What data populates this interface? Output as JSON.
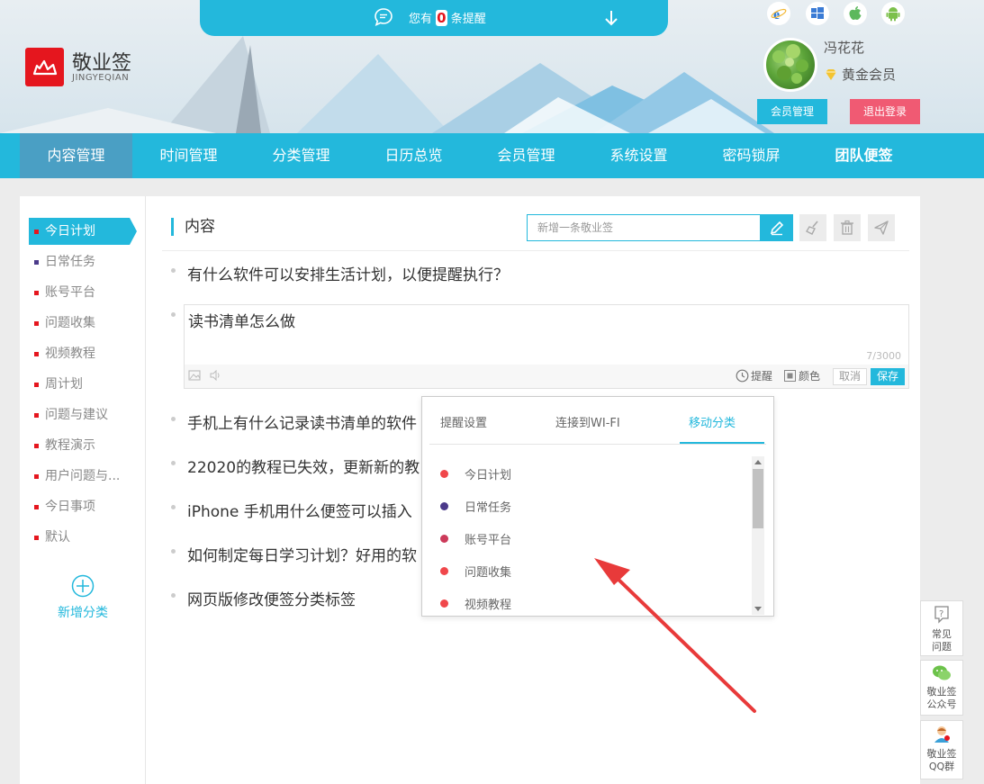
{
  "brand": {
    "name": "敬业签",
    "sub": "JINGYEQIAN"
  },
  "reminder": {
    "prefix": "您有",
    "count": "0",
    "suffix": "条提醒"
  },
  "platforms": [
    "ie-icon",
    "windows-icon",
    "apple-icon",
    "android-icon"
  ],
  "user": {
    "name": "冯花花",
    "level": "黄金会员"
  },
  "header_buttons": {
    "member_manage": "会员管理",
    "logout": "退出登录"
  },
  "nav": [
    "内容管理",
    "时间管理",
    "分类管理",
    "日历总览",
    "会员管理",
    "系统设置",
    "密码锁屏",
    "团队便签"
  ],
  "sidebar": {
    "items": [
      {
        "label": "今日计划",
        "color": "#e5161e"
      },
      {
        "label": "日常任务",
        "color": "#4b3a8a"
      },
      {
        "label": "账号平台",
        "color": "#e5161e"
      },
      {
        "label": "问题收集",
        "color": "#e5161e"
      },
      {
        "label": "视频教程",
        "color": "#e5161e"
      },
      {
        "label": "周计划",
        "color": "#e5161e"
      },
      {
        "label": "问题与建议",
        "color": "#e5161e"
      },
      {
        "label": "教程演示",
        "color": "#e5161e"
      },
      {
        "label": "用户问题与...",
        "color": "#e5161e"
      },
      {
        "label": "今日事项",
        "color": "#e5161e"
      },
      {
        "label": "默认",
        "color": "#e5161e"
      }
    ],
    "add_label": "新增分类"
  },
  "content": {
    "title": "内容",
    "new_placeholder": "新增一条敬业签",
    "notes": [
      "有什么软件可以安排生活计划，以便提醒执行？",
      "手机上有什么记录读书清单的软件",
      "22020的教程已失效，更新新的教",
      "iPhone 手机用什么便签可以插入",
      "如何制定每日学习计划？好用的软",
      "网页版修改便签分类标签"
    ],
    "editor": {
      "text": "读书清单怎么做",
      "count": "7/3000",
      "remind": "提醒",
      "color": "颜色",
      "cancel": "取消",
      "save": "保存"
    }
  },
  "popup": {
    "tabs": [
      "提醒设置",
      "连接到WI-FI",
      "移动分类"
    ],
    "items": [
      {
        "label": "今日计划",
        "color": "#f0474b"
      },
      {
        "label": "日常任务",
        "color": "#4b3a8a"
      },
      {
        "label": "账号平台",
        "color": "#cc3a5a"
      },
      {
        "label": "问题收集",
        "color": "#f0474b"
      },
      {
        "label": "视频教程",
        "color": "#f0474b"
      }
    ]
  },
  "widgets": {
    "faq": [
      "常见",
      "问题"
    ],
    "wechat": [
      "敬业签",
      "公众号"
    ],
    "qq": [
      "敬业签",
      "QQ群"
    ]
  }
}
